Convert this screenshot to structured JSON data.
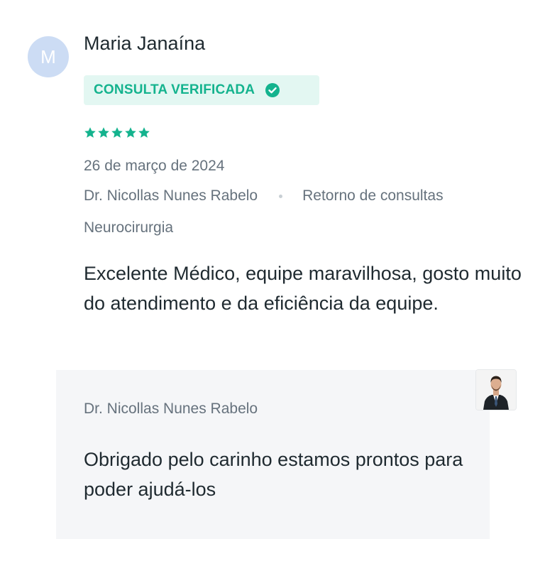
{
  "review": {
    "avatar_initial": "M",
    "author_name": "Maria Janaína",
    "verified_label": "CONSULTA VERIFICADA",
    "rating": 5,
    "rating_max": 5,
    "date": "26 de março de 2024",
    "doctor": "Dr. Nicollas Nunes Rabelo",
    "visit_type": "Retorno de consultas",
    "specialty": "Neurocirurgia",
    "text": "Excelente Médico, equipe maravilhosa, gosto muito do atendimento e da eficiência da equipe."
  },
  "reply": {
    "author": "Dr. Nicollas Nunes Rabelo",
    "text": "Obrigado pelo carinho estamos prontos para poder ajudá-los",
    "photo_icon": "doctor-photo"
  },
  "colors": {
    "accent_green": "#14b38e",
    "badge_bg": "#e3f7f2",
    "avatar_bg": "#ccdcf4",
    "muted_text": "#66727d",
    "reply_bg": "#f5f6f8"
  }
}
